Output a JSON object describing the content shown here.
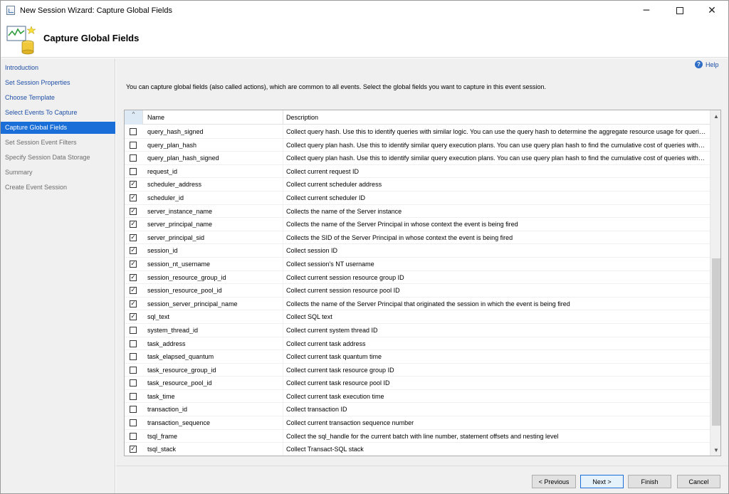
{
  "window": {
    "title": "New Session Wizard: Capture Global Fields",
    "minimize_glyph": "─",
    "close_glyph": "✕"
  },
  "header": {
    "title": "Capture Global Fields",
    "icon": "database-chart-icon"
  },
  "nav": {
    "items": [
      {
        "label": "Introduction",
        "state": "done"
      },
      {
        "label": "Set Session Properties",
        "state": "done"
      },
      {
        "label": "Choose Template",
        "state": "done"
      },
      {
        "label": "Select Events To Capture",
        "state": "done"
      },
      {
        "label": "Capture Global Fields",
        "state": "active"
      },
      {
        "label": "Set Session Event Filters",
        "state": "future"
      },
      {
        "label": "Specify Session Data Storage",
        "state": "future"
      },
      {
        "label": "Summary",
        "state": "future"
      },
      {
        "label": "Create Event Session",
        "state": "future"
      }
    ]
  },
  "help": {
    "label": "Help",
    "glyph": "?"
  },
  "description": "You can capture global fields (also called actions), which are common to all events. Select the global fields you want to capture in this event session.",
  "grid": {
    "sort_glyph": "^",
    "columns": {
      "name": "Name",
      "description": "Description"
    },
    "rows": [
      {
        "name": "query_hash_signed",
        "description": "Collect query hash. Use this to identify queries with similar logic. You can use the query hash to determine the aggregate resource usage for queries that differ only by literal values",
        "checked": false
      },
      {
        "name": "query_plan_hash",
        "description": "Collect query plan hash. Use this to identify similar query execution plans. You can use query plan hash to find the cumulative cost of queries with similar execution plans",
        "checked": false
      },
      {
        "name": "query_plan_hash_signed",
        "description": "Collect query plan hash. Use this to identify similar query execution plans. You can use query plan hash to find the cumulative cost of queries with similar execution plans",
        "checked": false
      },
      {
        "name": "request_id",
        "description": "Collect current request ID",
        "checked": false
      },
      {
        "name": "scheduler_address",
        "description": "Collect current scheduler address",
        "checked": true
      },
      {
        "name": "scheduler_id",
        "description": "Collect current scheduler ID",
        "checked": true
      },
      {
        "name": "server_instance_name",
        "description": "Collects the name of the Server instance",
        "checked": true
      },
      {
        "name": "server_principal_name",
        "description": "Collects the name of the Server Principal in whose context the event is being fired",
        "checked": true
      },
      {
        "name": "server_principal_sid",
        "description": "Collects the SID of the Server Principal in whose context the event is being fired",
        "checked": true
      },
      {
        "name": "session_id",
        "description": "Collect session ID",
        "checked": true
      },
      {
        "name": "session_nt_username",
        "description": "Collect session's NT username",
        "checked": true
      },
      {
        "name": "session_resource_group_id",
        "description": "Collect current session resource group ID",
        "checked": true
      },
      {
        "name": "session_resource_pool_id",
        "description": "Collect current session resource pool ID",
        "checked": true
      },
      {
        "name": "session_server_principal_name",
        "description": "Collects the name of the Server Principal that originated the session in which the event is being fired",
        "checked": true
      },
      {
        "name": "sql_text",
        "description": "Collect SQL text",
        "checked": true
      },
      {
        "name": "system_thread_id",
        "description": "Collect current system thread ID",
        "checked": false
      },
      {
        "name": "task_address",
        "description": "Collect current task address",
        "checked": false
      },
      {
        "name": "task_elapsed_quantum",
        "description": "Collect current task quantum time",
        "checked": false
      },
      {
        "name": "task_resource_group_id",
        "description": "Collect current task resource group ID",
        "checked": false
      },
      {
        "name": "task_resource_pool_id",
        "description": "Collect current task resource pool ID",
        "checked": false
      },
      {
        "name": "task_time",
        "description": "Collect current task execution time",
        "checked": false
      },
      {
        "name": "transaction_id",
        "description": "Collect transaction ID",
        "checked": false
      },
      {
        "name": "transaction_sequence",
        "description": "Collect current transaction sequence number",
        "checked": false
      },
      {
        "name": "tsql_frame",
        "description": "Collect the sql_handle for the current batch with line number, statement offsets and nesting level",
        "checked": false
      },
      {
        "name": "tsql_stack",
        "description": "Collect Transact-SQL stack",
        "checked": true
      }
    ]
  },
  "scrollbar": {
    "up_glyph": "▲",
    "down_glyph": "▼"
  },
  "footer": {
    "previous_label": "< Previous",
    "next_label": "Next >",
    "finish_label": "Finish",
    "cancel_label": "Cancel"
  },
  "colors": {
    "accent": "#1a6ed8",
    "link": "#1f4fa6",
    "panel": "#f0f0f0"
  }
}
